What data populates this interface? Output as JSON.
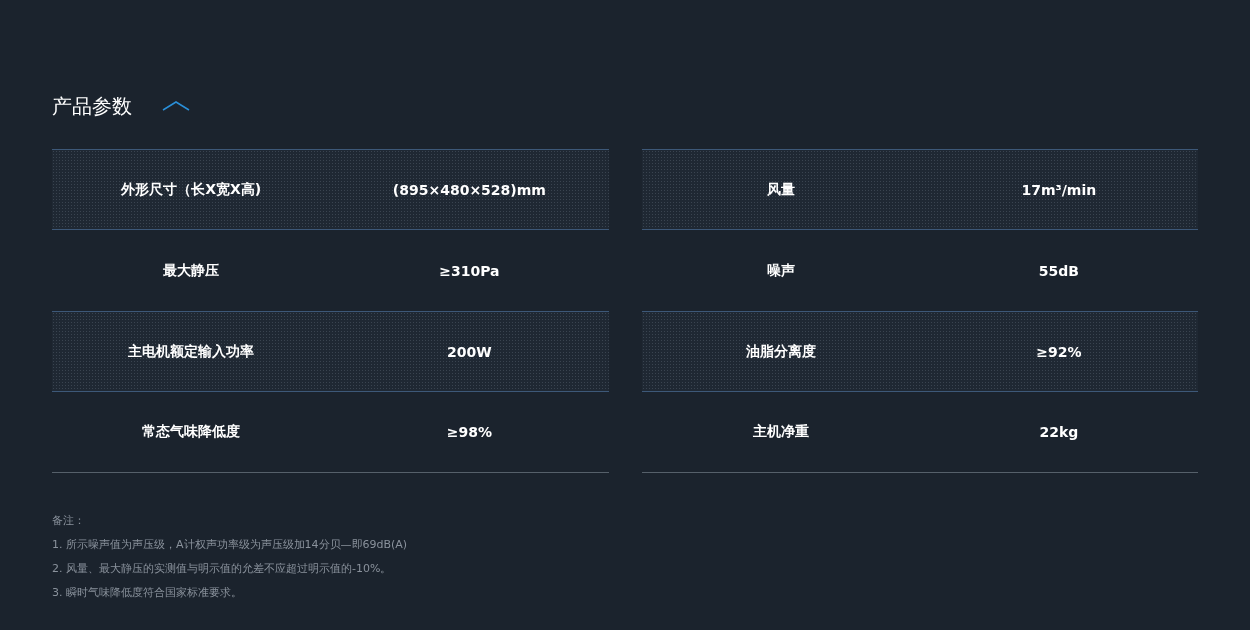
{
  "section": {
    "title": "产品参数",
    "expanded": true
  },
  "tables": [
    {
      "rows": [
        {
          "label": "外形尺寸（长X宽X高)",
          "value": "(895×480×528)mm"
        },
        {
          "label": "最大静压",
          "value": "≥310Pa"
        },
        {
          "label": "主电机额定输入功率",
          "value": "200W"
        },
        {
          "label": "常态气味降低度",
          "value": "≥98%"
        }
      ]
    },
    {
      "rows": [
        {
          "label": "风量",
          "value": "17m³/min"
        },
        {
          "label": "噪声",
          "value": "55dB"
        },
        {
          "label": "油脂分离度",
          "value": "≥92%"
        },
        {
          "label": "主机净重",
          "value": "22kg"
        }
      ]
    }
  ],
  "notes": {
    "title": "备注：",
    "items": [
      "1. 所示噪声值为声压级，A计权声功率级为声压级加14分贝—即69dB(A)",
      "2. 风量、最大静压的实测值与明示值的允差不应超过明示值的-10%。",
      "3. 瞬时气味降低度符合国家标准要求。"
    ]
  }
}
